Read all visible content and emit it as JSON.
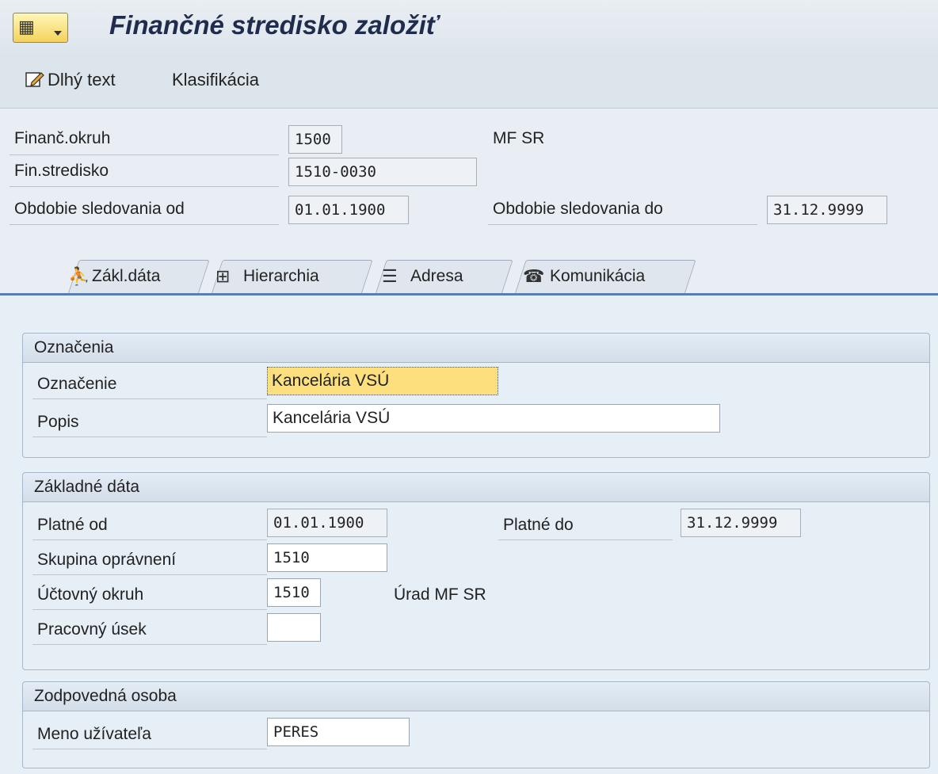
{
  "window": {
    "title": "Finančné stredisko založiť",
    "menu_icon": "sap-menu-icon"
  },
  "toolbar": {
    "long_text_label": "Dlhý text",
    "long_text_icon": "edit-pencil-icon",
    "classification_label": "Klasifikácia"
  },
  "header": {
    "fin_area_label": "Finanč.okruh",
    "fin_area_value": "1500",
    "fin_area_desc": "MF SR",
    "fin_center_label": "Fin.stredisko",
    "fin_center_value": "1510-0030",
    "period_from_label": "Obdobie sledovania od",
    "period_from_value": "01.01.1900",
    "period_to_label": "Obdobie sledovania do",
    "period_to_value": "31.12.9999"
  },
  "tabs": [
    {
      "label": "Zákl.dáta",
      "icon": "person-icon",
      "active": true
    },
    {
      "label": "Hierarchia",
      "icon": "hierarchy-icon",
      "active": false
    },
    {
      "label": "Adresa",
      "icon": "address-icon",
      "active": false
    },
    {
      "label": "Komunikácia",
      "icon": "telephone-icon",
      "active": false
    }
  ],
  "oznacenia": {
    "title": "Označenia",
    "name_label": "Označenie",
    "name_value": "Kancelária VSÚ",
    "desc_label": "Popis",
    "desc_value": "Kancelária VSÚ"
  },
  "zakladne": {
    "title": "Základné dáta",
    "valid_from_label": "Platné od",
    "valid_from_value": "01.01.1900",
    "valid_to_label": "Platné do",
    "valid_to_value": "31.12.9999",
    "auth_group_label": "Skupina oprávnení",
    "auth_group_value": "1510",
    "company_label": "Účtovný okruh",
    "company_value": "1510",
    "company_desc": "Úrad MF SR",
    "section_label": "Pracovný úsek",
    "section_value": ""
  },
  "zodpovedna": {
    "title": "Zodpovedná osoba",
    "user_label": "Meno užívateľa",
    "user_value": "PERES"
  },
  "colors": {
    "background": "#e8eef4",
    "focus_field": "#fde07d",
    "title_text": "#1f2c4d",
    "tab_line": "#5b7eb0"
  }
}
